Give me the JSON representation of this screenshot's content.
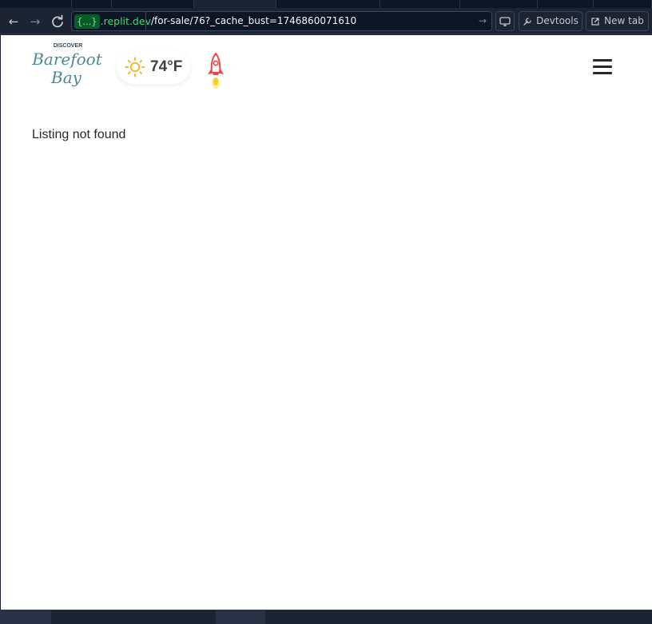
{
  "browser": {
    "url_domain_chip": "{...}",
    "url_domain_suffix": ".replit.dev",
    "url_path": "/for-sale/76?_cache_bust=1746860071610",
    "devtools_label": "Devtools",
    "new_tab_label": "New tab"
  },
  "site": {
    "logo": {
      "top": "DISCOVER",
      "line1": "Barefoot",
      "line2": "Bay"
    },
    "weather": {
      "temperature": "74°F",
      "icon": "sun-icon"
    },
    "rocket_icon": "rocket-icon",
    "menu_icon": "hamburger-menu-icon"
  },
  "main": {
    "message": "Listing not found"
  },
  "colors": {
    "accent_green": "#3fdc74",
    "page_bg": "#ffffff",
    "chrome_bg": "#1c2333",
    "text": "#27272a"
  }
}
